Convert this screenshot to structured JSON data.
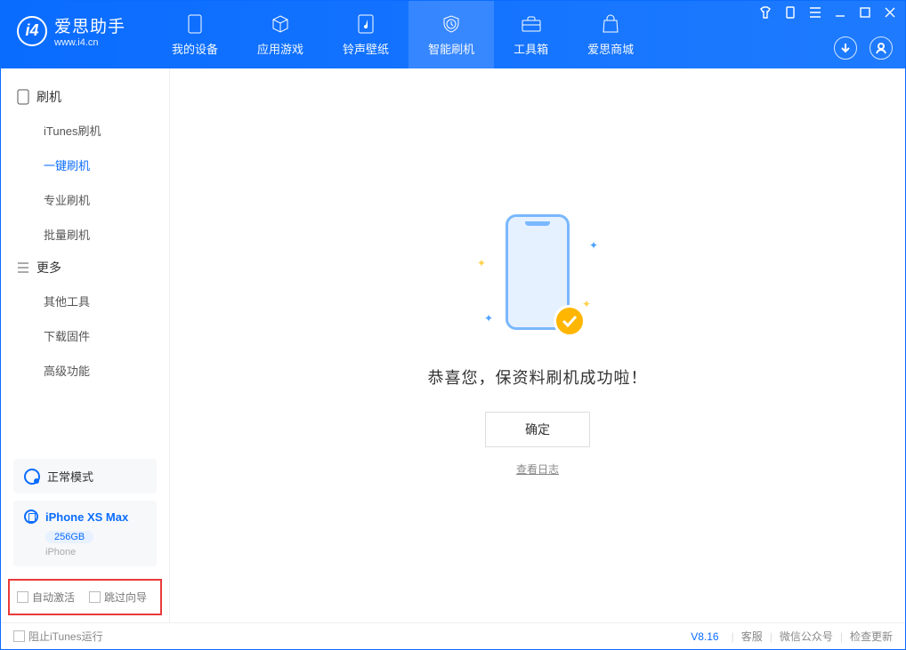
{
  "app": {
    "title": "爱思助手",
    "subtitle": "www.i4.cn"
  },
  "tabs": {
    "device": "我的设备",
    "apps": "应用游戏",
    "ringtone": "铃声壁纸",
    "flash": "智能刷机",
    "tools": "工具箱",
    "store": "爱思商城"
  },
  "sidebar": {
    "group1": "刷机",
    "items1": {
      "itunes": "iTunes刷机",
      "onekey": "一键刷机",
      "pro": "专业刷机",
      "batch": "批量刷机"
    },
    "group2": "更多",
    "items2": {
      "other": "其他工具",
      "firmware": "下载固件",
      "advanced": "高级功能"
    }
  },
  "device": {
    "mode": "正常模式",
    "name": "iPhone XS Max",
    "capacity": "256GB",
    "type": "iPhone"
  },
  "options": {
    "auto_activate": "自动激活",
    "skip_guide": "跳过向导"
  },
  "main": {
    "success_msg": "恭喜您，保资料刷机成功啦！",
    "ok": "确定",
    "view_log": "查看日志"
  },
  "footer": {
    "block_itunes": "阻止iTunes运行",
    "version": "V8.16",
    "support": "客服",
    "wechat": "微信公众号",
    "update": "检查更新"
  }
}
